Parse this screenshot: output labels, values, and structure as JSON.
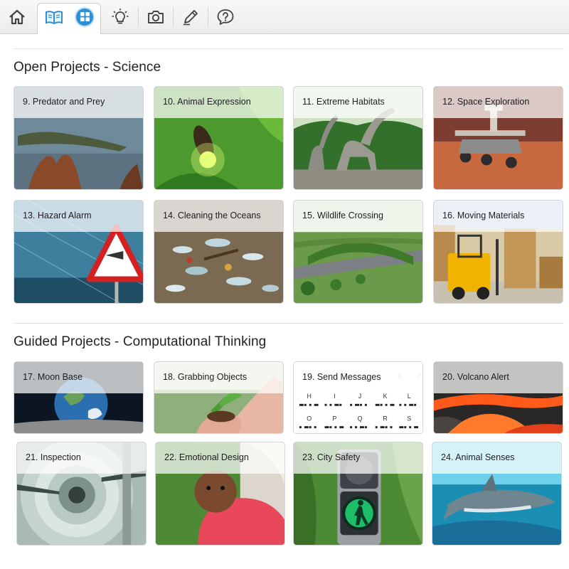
{
  "toolbar": {
    "items": [
      {
        "icon": "home-icon"
      },
      {
        "icon": "book-icon",
        "active": true
      },
      {
        "icon": "grid-icon",
        "active": true
      },
      {
        "icon": "lightbulb-icon"
      },
      {
        "icon": "camera-icon"
      },
      {
        "icon": "pencil-icon"
      },
      {
        "icon": "help-icon"
      }
    ],
    "accent": "#2d8fd6"
  },
  "sections": [
    {
      "title": "Open Projects - Science",
      "cards": [
        {
          "label": "9. Predator and Prey"
        },
        {
          "label": "10. Animal Expression"
        },
        {
          "label": "11. Extreme Habitats"
        },
        {
          "label": "12. Space Exploration"
        },
        {
          "label": "13. Hazard Alarm"
        },
        {
          "label": "14. Cleaning the Oceans"
        },
        {
          "label": "15. Wildlife Crossing"
        },
        {
          "label": "16. Moving Materials"
        }
      ]
    },
    {
      "title": "Guided Projects - Computational Thinking",
      "cards": [
        {
          "label": "17. Moon Base"
        },
        {
          "label": "18. Grabbing Objects"
        },
        {
          "label": "19. Send Messages"
        },
        {
          "label": "20. Volcano Alert"
        },
        {
          "label": "21. Inspection"
        },
        {
          "label": "22. Emotional Design"
        },
        {
          "label": "23. City Safety"
        },
        {
          "label": "24. Animal Senses"
        }
      ]
    }
  ],
  "morse_letters": [
    "H",
    "I",
    "J",
    "K",
    "L",
    "O",
    "P",
    "Q",
    "R",
    "S",
    "E",
    "F"
  ]
}
